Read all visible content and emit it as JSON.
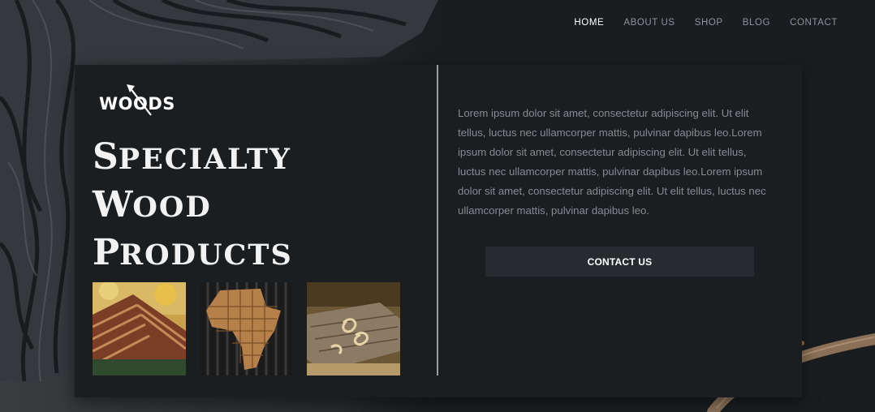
{
  "brand": {
    "logo_text": "WOODS"
  },
  "nav": {
    "items": [
      {
        "label": "HOME",
        "active": true
      },
      {
        "label": "ABOUT US",
        "active": false
      },
      {
        "label": "SHOP",
        "active": false
      },
      {
        "label": "BLOG",
        "active": false
      },
      {
        "label": "CONTACT",
        "active": false
      }
    ]
  },
  "hero": {
    "title_lines": [
      {
        "cap": "S",
        "rest": "PECIALTY"
      },
      {
        "cap": "W",
        "rest": "OOD"
      },
      {
        "cap": "P",
        "rest": "RODUCTS"
      }
    ],
    "description": "Lorem ipsum dolor sit amet, consectetur adipiscing elit. Ut elit tellus, luctus nec ullamcorper mattis, pulvinar dapibus leo.Lorem ipsum dolor sit amet, consectetur adipiscing elit. Ut elit tellus, luctus nec ullamcorper mattis, pulvinar dapibus leo.Lorem ipsum dolor sit amet, consectetur adipiscing elit. Ut elit tellus, luctus nec ullamcorper mattis, pulvinar dapibus leo.",
    "cta_label": "CONTACT US"
  },
  "gallery": {
    "images": [
      {
        "name": "wooden-roof-image"
      },
      {
        "name": "wood-africa-map-image"
      },
      {
        "name": "wood-shavings-image"
      }
    ]
  },
  "colors": {
    "background": "#1a1d20",
    "card": "#1b1e21",
    "button": "#272b30",
    "nav_active": "#ffffff",
    "nav_inactive": "#8e949a",
    "body_text": "#868b90"
  }
}
